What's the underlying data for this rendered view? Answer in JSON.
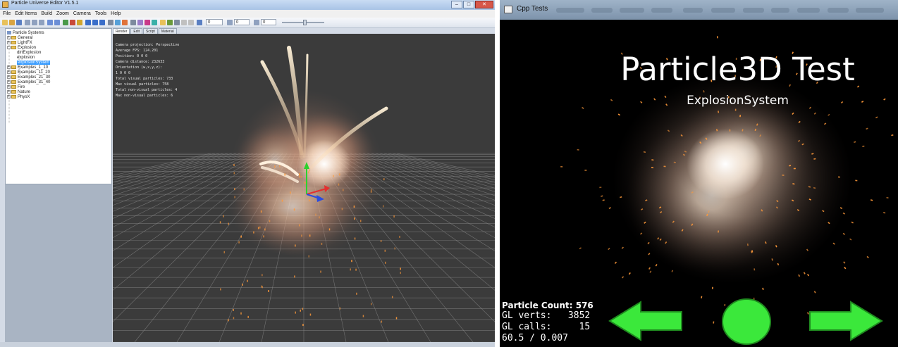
{
  "left_window": {
    "title": "Particle Universe Editor V1.5.1",
    "window_buttons": [
      "–",
      "□",
      "✕"
    ],
    "menu": [
      "File",
      "Edit Items",
      "Build",
      "Zoom",
      "Camera",
      "Tools",
      "Help"
    ],
    "toolbar_fields": [
      "0",
      "0",
      "0"
    ],
    "tree": {
      "root": "Particle Systems",
      "items": [
        {
          "label": "General",
          "level": 1,
          "folder": true
        },
        {
          "label": "LightFX",
          "level": 1,
          "folder": true
        },
        {
          "label": "Explosion",
          "level": 1,
          "folder": true,
          "expanded": true
        },
        {
          "label": "dirtExplosion",
          "level": 2,
          "folder": false
        },
        {
          "label": "explosion",
          "level": 2,
          "folder": false
        },
        {
          "label": "explosionSystem",
          "level": 2,
          "folder": false,
          "selected": true
        },
        {
          "label": "Examples_1_10",
          "level": 1,
          "folder": true
        },
        {
          "label": "Examples_11_20",
          "level": 1,
          "folder": true
        },
        {
          "label": "Examples_21_30",
          "level": 1,
          "folder": true
        },
        {
          "label": "Examples_31_40",
          "level": 1,
          "folder": true
        },
        {
          "label": "Fire",
          "level": 1,
          "folder": true
        },
        {
          "label": "Nature",
          "level": 1,
          "folder": true
        },
        {
          "label": "PhysX",
          "level": 1,
          "folder": true
        }
      ]
    },
    "tabs": [
      {
        "label": "Render",
        "active": true
      },
      {
        "label": "Edit",
        "active": false
      },
      {
        "label": "Script",
        "active": false
      },
      {
        "label": "Material",
        "active": false
      }
    ],
    "stats": [
      "Camera projection: Perspective",
      "Average FPS: 124.201",
      "Position: 0 0 0",
      "Camera distance: 232633",
      "Orientation (w,x,y,z):",
      "  1 0 0 0",
      "Total visual particles: 733",
      "Max visual particles: 758",
      "Total non-visual particles: 4",
      "Max non-visual particles: 6"
    ]
  },
  "right_window": {
    "title": "Cpp Tests",
    "heading": "Particle3D Test",
    "subtitle": "ExplosionSystem",
    "particle_count": "Particle Count: 576",
    "gl_verts": "GL verts:   3852",
    "gl_calls": "GL calls:     15",
    "fps": "60.5 / 0.007",
    "buttons": [
      "back-arrow",
      "restart-circle",
      "next-arrow"
    ],
    "button_color": "#3be83b"
  },
  "colors": {
    "viewport_bg": "#3b3b3b",
    "grid_line": "#8a8a8a",
    "selection": "#3399ff",
    "smoke": "#e9b89a",
    "spark": "#ff9a3a"
  }
}
